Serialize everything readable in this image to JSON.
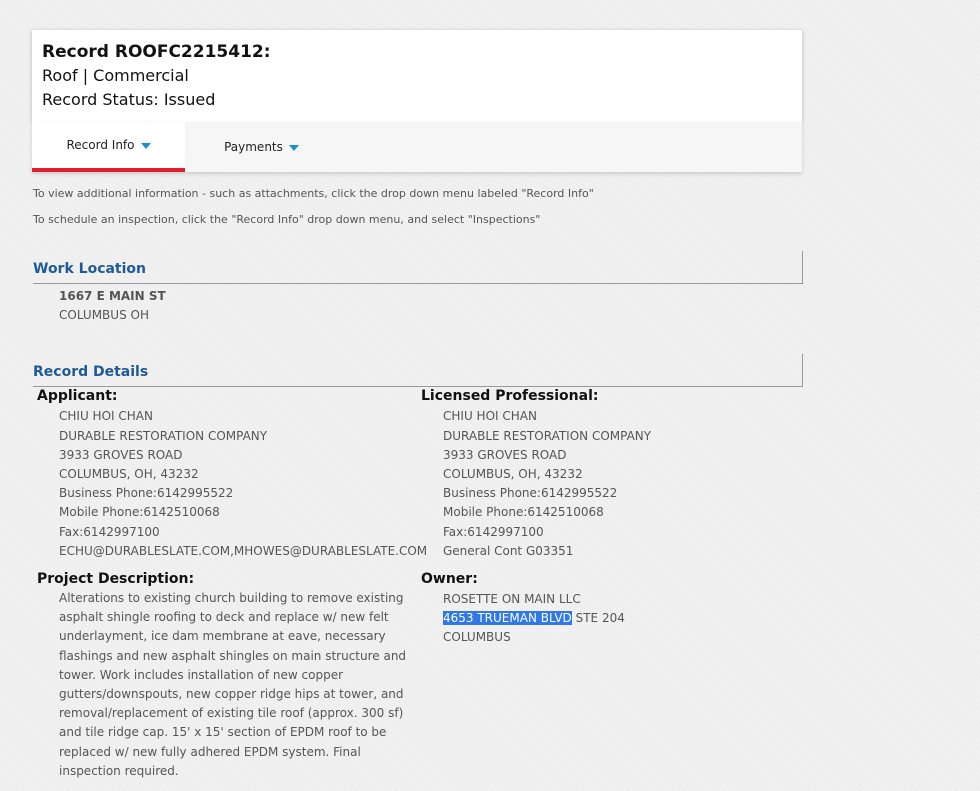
{
  "header": {
    "record_title": "Record ROOFC2215412:",
    "record_type": "Roof | Commercial",
    "record_status": "Record Status: Issued"
  },
  "tabs": [
    {
      "label": "Record Info",
      "active": true
    },
    {
      "label": "Payments",
      "active": false
    }
  ],
  "hints": [
    "To view additional information - such as attachments, click the drop down menu labeled \"Record Info\"",
    "To schedule an inspection, click the \"Record Info\" drop down menu, and select \"Inspections\""
  ],
  "work_location": {
    "heading": "Work Location",
    "address_line1": "1667 E MAIN ST",
    "address_line2": "COLUMBUS OH"
  },
  "record_details": {
    "heading": "Record Details",
    "applicant": {
      "label": "Applicant:",
      "lines": [
        "CHIU HOI CHAN",
        "DURABLE RESTORATION COMPANY",
        "3933 GROVES ROAD",
        "COLUMBUS, OH, 43232",
        "Business Phone:6142995522",
        "Mobile Phone:6142510068",
        "Fax:6142997100",
        "ECHU@DURABLESLATE.COM,MHOWES@DURABLESLATE.COM"
      ]
    },
    "licensed_professional": {
      "label": "Licensed Professional:",
      "lines": [
        "CHIU HOI CHAN",
        "DURABLE RESTORATION COMPANY",
        "3933 GROVES ROAD",
        "COLUMBUS, OH, 43232",
        "Business Phone:6142995522",
        "Mobile Phone:6142510068",
        "Fax:6142997100",
        "General Cont G03351"
      ]
    },
    "project_description": {
      "label": "Project Description:",
      "text": "Alterations to existing church building to remove existing asphalt shingle roofing to deck and replace w/ new felt underlayment, ice dam membrane at eave, necessary flashings and new asphalt shingles on main structure and tower. Work includes installation of new copper gutters/downspouts, new copper ridge hips at tower, and removal/replacement of existing tile roof (approx. 300 sf) and tile ridge cap. 15' x 15' section of EPDM roof to be replaced w/ new fully adhered EPDM system. Final inspection required."
    },
    "owner": {
      "label": "Owner:",
      "name": "ROSETTE ON MAIN LLC",
      "address_selected": "4653 TRUEMAN BLVD",
      "address_rest": " STE 204",
      "city": "COLUMBUS"
    }
  }
}
